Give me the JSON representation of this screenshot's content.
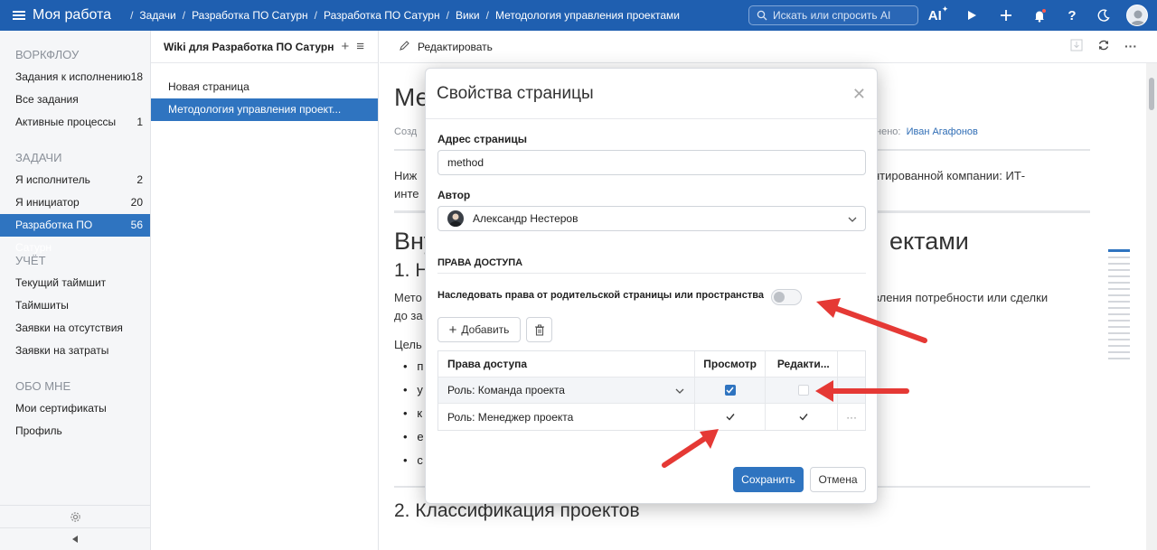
{
  "topbar": {
    "app_title": "Моя работа",
    "breadcrumbs": [
      "Задачи",
      "Разработка ПО Сатурн",
      "Разработка ПО Сатурн",
      "Вики",
      "Методология управления проектами"
    ],
    "search_placeholder": "Искать или спросить AI",
    "ai_label": "AI"
  },
  "sidebar": {
    "sections": [
      {
        "title": "ВОРКФЛОУ",
        "items": [
          {
            "label": "Задания к исполнению",
            "count": "18"
          },
          {
            "label": "Все задания",
            "count": ""
          },
          {
            "label": "Активные процессы",
            "count": "1"
          }
        ]
      },
      {
        "title": "ЗАДАЧИ",
        "items": [
          {
            "label": "Я исполнитель",
            "count": "2"
          },
          {
            "label": "Я инициатор",
            "count": "20"
          },
          {
            "label": "Разработка ПО Сатурн",
            "count": "56"
          }
        ]
      },
      {
        "title": "УЧЁТ",
        "items": [
          {
            "label": "Текущий таймшит",
            "count": ""
          },
          {
            "label": "Таймшиты",
            "count": ""
          },
          {
            "label": "Заявки на отсутствия",
            "count": ""
          },
          {
            "label": "Заявки на затраты",
            "count": ""
          }
        ]
      },
      {
        "title": "ОБО МНЕ",
        "items": [
          {
            "label": "Мои сертификаты",
            "count": ""
          },
          {
            "label": "Профиль",
            "count": ""
          }
        ]
      }
    ]
  },
  "wiki": {
    "title": "Wiki для Разработка ПО Сатурн",
    "pages": [
      "Новая страница",
      "Методология управления проект..."
    ]
  },
  "main": {
    "edit_label": "Редактировать",
    "doc_title": "Методология управления проектами",
    "meta_prefix": "Созд",
    "meta_suffix": "нено:",
    "meta_author": "Иван Агафонов",
    "intro_left": "Ниж",
    "intro_left2": "инте",
    "intro_right": "нтированной компании: ИТ-",
    "h2_left": "Вну",
    "h2_right": "ектами",
    "h3_left": "1. Н",
    "p2_left": "Мето",
    "p2_left2": "до за",
    "p2_right": "вления потребности или сделки",
    "p3_left": "Цель",
    "bullets": [
      "п",
      "у",
      "к",
      "е",
      "с"
    ],
    "h_bottom": "2. Классификация проектов"
  },
  "modal": {
    "title": "Свойства страницы",
    "address_label": "Адрес страницы",
    "address_value": "method",
    "author_label": "Автор",
    "author_value": "Александр Нестеров",
    "access_title": "ПРАВА ДОСТУПА",
    "inherit_label": "Наследовать права от родительской страницы или пространства",
    "add_label": "Добавить",
    "columns": [
      "Права доступа",
      "Просмотр",
      "Редакти..."
    ],
    "rows": [
      {
        "role": "Роль: Команда проекта",
        "view": true,
        "edit": false
      },
      {
        "role": "Роль: Менеджер проекта",
        "view": true,
        "edit": true
      }
    ],
    "more_label": "···",
    "save_label": "Сохранить",
    "cancel_label": "Отмена"
  },
  "colors": {
    "primary": "#1f5fb0",
    "accent": "#2f74c0",
    "arrow": "#e53935"
  }
}
